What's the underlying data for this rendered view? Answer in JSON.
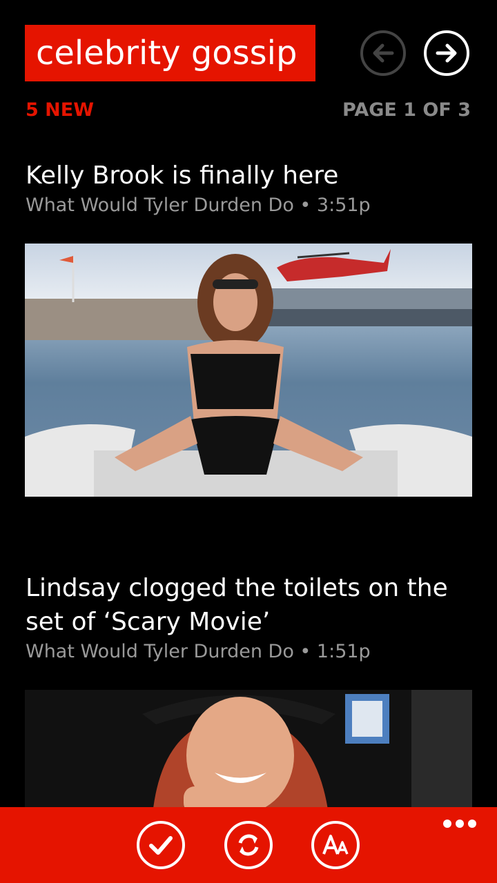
{
  "header": {
    "title": "celebrity gossip"
  },
  "status": {
    "new_count": "5 NEW",
    "page_indicator": "PAGE 1 OF 3"
  },
  "nav": {
    "prev_icon": "arrow-left-icon",
    "next_icon": "arrow-right-icon"
  },
  "articles": [
    {
      "title": "Kelly Brook is finally here",
      "meta": "What Would Tyler Durden Do • 3:51p"
    },
    {
      "title": "Lindsay clogged the toilets on the set of ‘Scary Movie’",
      "meta": "What Would Tyler Durden Do • 1:51p"
    }
  ],
  "appbar": {
    "buttons": [
      "check-icon",
      "refresh-icon",
      "text-size-icon"
    ],
    "more_icon": "ellipsis-icon",
    "text_size_glyph": "AA"
  },
  "colors": {
    "accent": "#e51400",
    "background": "#000000",
    "meta_text": "#9a9a9a"
  }
}
